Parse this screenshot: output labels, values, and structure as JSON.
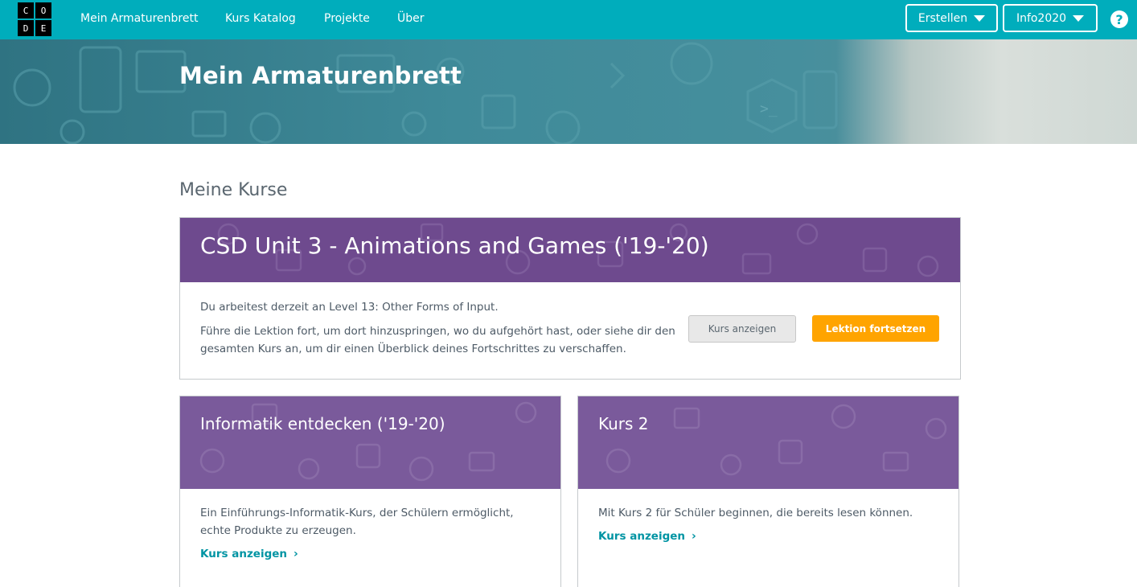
{
  "logo": {
    "letters": [
      "C",
      "O",
      "D",
      "E"
    ]
  },
  "nav": {
    "items": [
      {
        "label": "Mein Armaturenbrett"
      },
      {
        "label": "Kurs Katalog"
      },
      {
        "label": "Projekte"
      },
      {
        "label": "Über"
      }
    ],
    "create_label": "Erstellen",
    "user_label": "Info2020",
    "help_icon": "question-mark-icon"
  },
  "hero": {
    "title": "Mein Armaturenbrett"
  },
  "section": {
    "title": "Meine Kurse"
  },
  "current_course": {
    "title": "CSD Unit 3 - Animations and Games ('19-'20)",
    "status": "Du arbeitest derzeit an Level 13: Other Forms of Input.",
    "description": "Führe die Lektion fort, um dort hinzuspringen, wo du aufgehört hast, oder siehe dir den gesamten Kurs an, um dir einen Überblick deines Fortschrittes zu verschaffen.",
    "view_button": "Kurs anzeigen",
    "continue_button": "Lektion fortsetzen"
  },
  "courses": [
    {
      "title": "Informatik entdecken ('19-'20)",
      "description": "Ein Einführungs-Informatik-Kurs, der Schülern ermöglicht, echte Produkte zu erzeugen.",
      "link": "Kurs anzeigen"
    },
    {
      "title": "Kurs 2",
      "description": "Mit Kurs 2 für Schüler beginnen, die bereits lesen können.",
      "link": "Kurs anzeigen"
    }
  ],
  "colors": {
    "topbar": "#00adbc",
    "card_header": "#6e4a8e",
    "orange": "#ffa400",
    "link": "#0094a3"
  }
}
